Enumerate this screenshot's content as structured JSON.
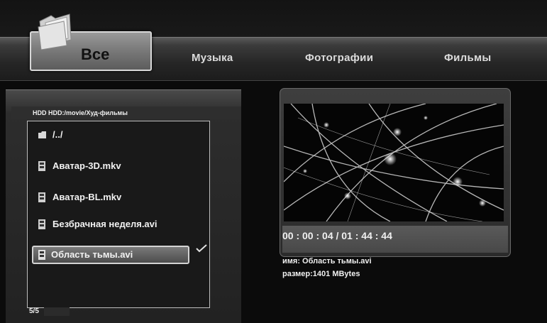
{
  "tabs": [
    {
      "label": "Все"
    },
    {
      "label": "Музыка"
    },
    {
      "label": "Фотографии"
    },
    {
      "label": "Фильмы"
    }
  ],
  "browser": {
    "path": "HDD HDD:/movie/Худ-фильмы",
    "items": [
      {
        "label": "/../",
        "icon": "folder-icon"
      },
      {
        "label": "Аватар-3D.mkv",
        "icon": "video-file-icon"
      },
      {
        "label": "Аватар-BL.mkv",
        "icon": "video-file-icon"
      },
      {
        "label": "Безбрачная неделя.avi",
        "icon": "video-file-icon"
      },
      {
        "label": "Область тьмы.avi",
        "icon": "video-file-icon"
      }
    ],
    "pager": "5/5"
  },
  "preview": {
    "time": "00 : 00 : 04 / 01 : 44 : 44",
    "name": "имя: Область тьмы.avi",
    "size": "размер:1401 MBytes"
  }
}
